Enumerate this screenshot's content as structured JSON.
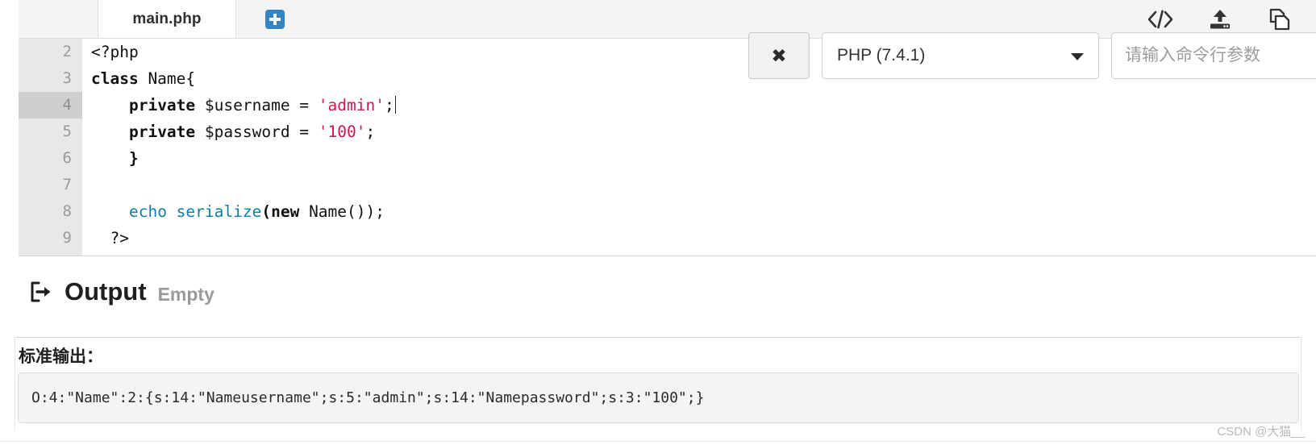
{
  "editor": {
    "tab": {
      "filename": "main.php"
    },
    "add_tab_icon": "plus-square-icon",
    "toolbar_icons": [
      {
        "name": "code-brackets-icon",
        "label": "</>"
      },
      {
        "name": "upload-icon",
        "label": "upload"
      },
      {
        "name": "copy-files-icon",
        "label": "copy"
      }
    ],
    "gutter": {
      "line_numbers": [
        "2",
        "3",
        "4",
        "5",
        "6",
        "7",
        "8",
        "9"
      ],
      "active_line": "4"
    },
    "code_lines": [
      {
        "n": "2",
        "tokens": [
          {
            "t": "<?php",
            "c": "plain"
          }
        ]
      },
      {
        "n": "3",
        "tokens": [
          {
            "t": "class",
            "c": "kw"
          },
          {
            "t": " Name{",
            "c": "plain"
          }
        ]
      },
      {
        "n": "4",
        "tokens": [
          {
            "t": "    ",
            "c": "plain"
          },
          {
            "t": "private",
            "c": "kw"
          },
          {
            "t": " $username = ",
            "c": "plain"
          },
          {
            "t": "'admin'",
            "c": "str"
          },
          {
            "t": ";",
            "c": "plain"
          }
        ],
        "caret": true
      },
      {
        "n": "5",
        "tokens": [
          {
            "t": "    ",
            "c": "plain"
          },
          {
            "t": "private",
            "c": "kw"
          },
          {
            "t": " $password = ",
            "c": "plain"
          },
          {
            "t": "'100'",
            "c": "str"
          },
          {
            "t": ";",
            "c": "plain"
          }
        ]
      },
      {
        "n": "6",
        "tokens": [
          {
            "t": "    }",
            "c": "kw"
          }
        ]
      },
      {
        "n": "7",
        "tokens": [
          {
            "t": "",
            "c": "plain"
          }
        ]
      },
      {
        "n": "8",
        "tokens": [
          {
            "t": "    ",
            "c": "plain"
          },
          {
            "t": "echo serialize",
            "c": "fn"
          },
          {
            "t": "(",
            "c": "kw"
          },
          {
            "t": "new",
            "c": "kw"
          },
          {
            "t": " Name());",
            "c": "plain"
          }
        ]
      },
      {
        "n": "9",
        "tokens": [
          {
            "t": "  ?>",
            "c": "plain"
          }
        ]
      }
    ]
  },
  "run_controls": {
    "stop_button_label": "✖",
    "stop_icon": "close-x-icon",
    "language": {
      "selected": "PHP (7.4.1)",
      "options": [
        "PHP (7.4.1)"
      ]
    },
    "args_input": {
      "value": "",
      "placeholder": "请输入命令行参数"
    }
  },
  "output": {
    "icon": "sign-out-icon",
    "title": "Output",
    "status": "Empty",
    "stdout_label": "标准输出：",
    "stdout_text": "O:4:\"Name\":2:{s:14:\"Nameusername\";s:5:\"admin\";s:14:\"Namepassword\";s:3:\"100\";}"
  },
  "watermark": {
    "text": "CSDN @大猫__"
  },
  "colors": {
    "string_token": "#d2154f",
    "function_token": "#0b7fab",
    "accent_blue": "#3585c4",
    "gutter_bg": "#e8e8e8",
    "active_line_bg": "#cfcfcf",
    "stdout_bg": "#f4f4f4"
  }
}
